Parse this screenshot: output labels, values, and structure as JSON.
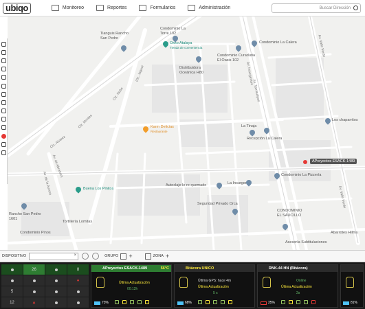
{
  "header": {
    "logo": "ubiqo",
    "nav": [
      "Monitoreo",
      "Reportes",
      "Formularios",
      "Administración"
    ],
    "search_placeholder": "Buscar Dirección"
  },
  "map": {
    "pois": [
      {
        "name": "Tianguis Rancho San Pedro",
        "style": "normal"
      },
      {
        "name": "Condominio La Torre 102",
        "style": "normal"
      },
      {
        "name": "Oxxo Atalaya",
        "style": "teal"
      },
      {
        "name": "Tienda de conveniencia",
        "style": "teal"
      },
      {
        "name": "Condominio Curaduria El Oasis 102",
        "style": "normal"
      },
      {
        "name": "Distribuidora Oceánica H80",
        "style": "normal"
      },
      {
        "name": "Condominio La Calera",
        "style": "normal"
      },
      {
        "name": "Karm Delicias",
        "style": "orange"
      },
      {
        "name": "Restaurante",
        "style": "orange"
      },
      {
        "name": "La Tinaja",
        "style": "normal"
      },
      {
        "name": "Recepción La Calera",
        "style": "normal"
      },
      {
        "name": "Los chaparritos",
        "style": "normal"
      },
      {
        "name": "Condominio La Pizzería",
        "style": "normal"
      },
      {
        "name": "Buena Los Pinitos",
        "style": "teal"
      },
      {
        "name": "Autoclaje le re quemado",
        "style": "normal"
      },
      {
        "name": "La Insurgente",
        "style": "normal"
      },
      {
        "name": "Seguridad Privado Orca",
        "style": "normal"
      },
      {
        "name": "CONDOMINIO EL SAUCILLO",
        "style": "normal"
      },
      {
        "name": "Asesoría Subtitulaciones",
        "style": "normal"
      },
      {
        "name": "Tortillería Lomitas",
        "style": "normal"
      },
      {
        "name": "Abarrotes Hilma",
        "style": "normal"
      },
      {
        "name": "Rancho San Pedro 1601",
        "style": "normal"
      },
      {
        "name": "Condominio Pinos",
        "style": "normal"
      }
    ],
    "streets": [
      "Clz. Alvarez",
      "Clz. Montes",
      "Clz. Nube",
      "Clz. Jaguar",
      "Av. Insurgentes",
      "Av. Tamaulipas",
      "Av. Valle Verde",
      "Av. Valle Verde",
      "Av. de la Aurora",
      "Av. de Abraham"
    ],
    "vehicle_label": "APreyectos ESACK-1489"
  },
  "filterbar": {
    "device_label": "DISPOSITIVO",
    "group_label": "GRUPO",
    "zone_label": "ZONA"
  },
  "summary_grid": [
    [
      "",
      "26",
      "",
      "8"
    ],
    [
      "",
      "",
      "",
      ""
    ],
    [
      "5",
      "",
      "",
      ""
    ],
    [
      "12",
      "",
      "",
      ""
    ]
  ],
  "cards": [
    {
      "title": "APreyectos ESACK-1489",
      "meta": "56°C",
      "line1": "Última Actualización",
      "line2": "00:12h",
      "battery": "73%"
    },
    {
      "title": "Bitácora UNICO",
      "meta": "",
      "line1": "Última GPS: hace 4m",
      "line2": "Última Actualización",
      "line3": "5 s",
      "battery": "68%"
    },
    {
      "title": "RNK-44 HN (Bitácora)",
      "meta": "",
      "line1": "Online",
      "line2": "Última Actualización",
      "line3": "2s",
      "battery": "25%"
    },
    {
      "title": "",
      "meta": "",
      "line1": "",
      "line2": "",
      "battery": "81%"
    }
  ]
}
